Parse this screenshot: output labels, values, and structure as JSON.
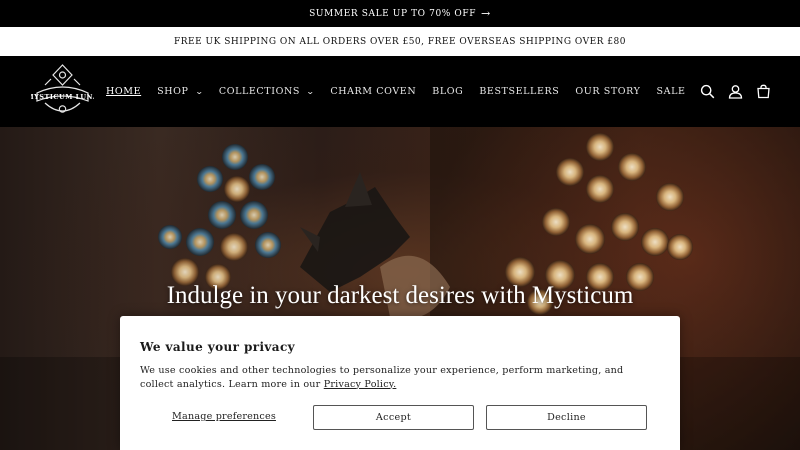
{
  "announcement": {
    "text": "SUMMER SALE UP TO 70% OFF",
    "arrow": "→"
  },
  "shipping_notice": "FREE UK SHIPPING ON ALL ORDERS OVER £50, FREE OVERSEAS SHIPPING OVER £80",
  "logo": {
    "text": "MYSTICUM LUNA"
  },
  "nav": {
    "items": [
      {
        "label": "HOME",
        "active": true,
        "dropdown": false
      },
      {
        "label": "SHOP",
        "active": false,
        "dropdown": true
      },
      {
        "label": "COLLECTIONS",
        "active": false,
        "dropdown": true
      },
      {
        "label": "CHARM COVEN",
        "active": false,
        "dropdown": false
      },
      {
        "label": "BLOG",
        "active": false,
        "dropdown": false
      },
      {
        "label": "BESTSELLERS",
        "active": false,
        "dropdown": false
      },
      {
        "label": "OUR STORY",
        "active": false,
        "dropdown": false
      },
      {
        "label": "SALE",
        "active": false,
        "dropdown": false
      }
    ]
  },
  "header_icons": [
    "search-icon",
    "account-icon",
    "cart-icon"
  ],
  "hero": {
    "title": "Indulge in your darkest desires with Mysticum"
  },
  "cookie_banner": {
    "title": "We value your privacy",
    "text_before_link": "We use cookies and other technologies to personalize your experience, perform marketing, and collect analytics. Learn more in our ",
    "link_text": "Privacy Policy.",
    "manage_label": "Manage preferences",
    "accept_label": "Accept",
    "decline_label": "Decline"
  },
  "colors": {
    "bar_bg": "#000000",
    "banner_bg": "#ffffff",
    "text_dark": "#222222"
  }
}
